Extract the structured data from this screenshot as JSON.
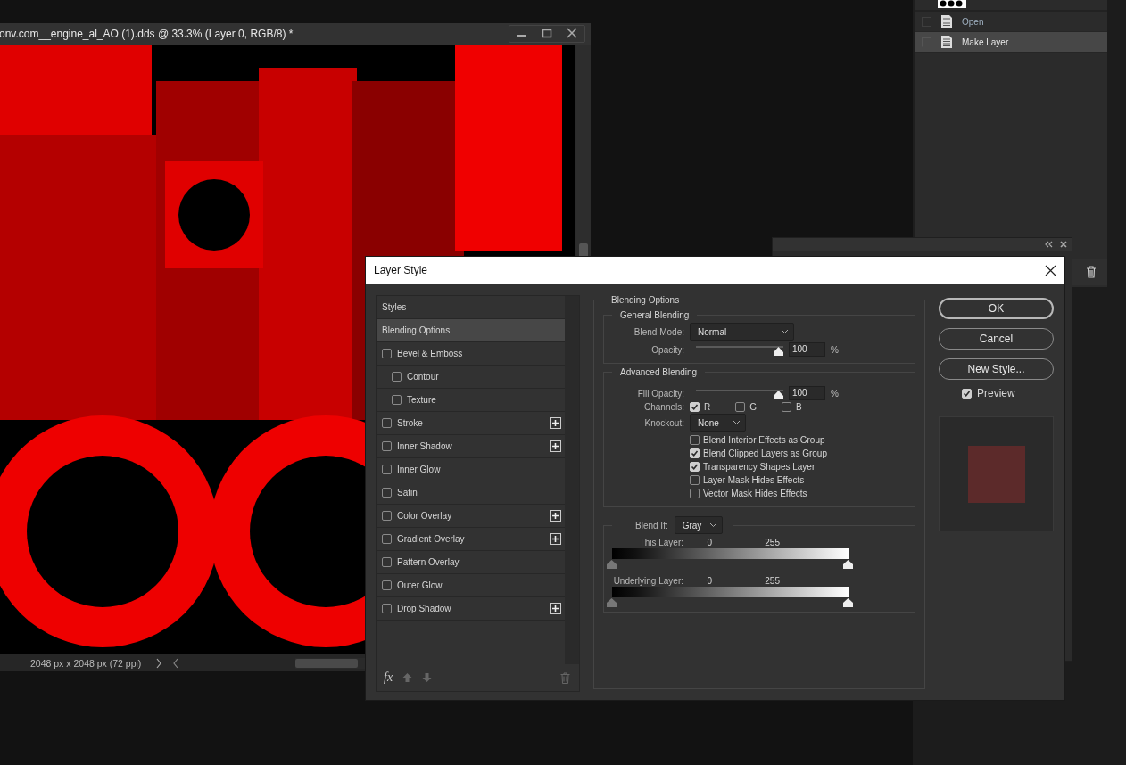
{
  "document": {
    "title": "onv.com__engine_al_AO (1).dds @ 33.3% (Layer 0, RGB/8) *",
    "status": "2048 px x 2048 px (72 ppi)"
  },
  "history": {
    "items": [
      {
        "label": "Open",
        "selected": false
      },
      {
        "label": "Make Layer",
        "selected": true
      }
    ]
  },
  "dialog": {
    "title": "Layer Style",
    "styles": [
      {
        "kind": "heading",
        "label": "Styles",
        "selected": false
      },
      {
        "kind": "heading",
        "label": "Blending Options",
        "selected": true
      },
      {
        "kind": "effect",
        "label": "Bevel & Emboss",
        "checked": false,
        "addable": false,
        "selected": false
      },
      {
        "kind": "sub",
        "label": "Contour",
        "checked": false,
        "addable": false,
        "selected": false
      },
      {
        "kind": "sub",
        "label": "Texture",
        "checked": false,
        "addable": false,
        "selected": false
      },
      {
        "kind": "effect",
        "label": "Stroke",
        "checked": false,
        "addable": true,
        "selected": false
      },
      {
        "kind": "effect",
        "label": "Inner Shadow",
        "checked": false,
        "addable": true,
        "selected": false
      },
      {
        "kind": "effect",
        "label": "Inner Glow",
        "checked": false,
        "addable": false,
        "selected": false
      },
      {
        "kind": "effect",
        "label": "Satin",
        "checked": false,
        "addable": false,
        "selected": false
      },
      {
        "kind": "effect",
        "label": "Color Overlay",
        "checked": false,
        "addable": true,
        "selected": false
      },
      {
        "kind": "effect",
        "label": "Gradient Overlay",
        "checked": false,
        "addable": true,
        "selected": false
      },
      {
        "kind": "effect",
        "label": "Pattern Overlay",
        "checked": false,
        "addable": false,
        "selected": false
      },
      {
        "kind": "effect",
        "label": "Outer Glow",
        "checked": false,
        "addable": false,
        "selected": false
      },
      {
        "kind": "effect",
        "label": "Drop Shadow",
        "checked": false,
        "addable": true,
        "selected": false
      }
    ],
    "fx_label": "fx",
    "blending": {
      "legend": "Blending Options",
      "general": {
        "legend": "General Blending",
        "blend_mode_label": "Blend Mode:",
        "blend_mode": "Normal",
        "opacity_label": "Opacity:",
        "opacity": {
          "level": 1,
          "value": "100",
          "unit": "%"
        }
      },
      "advanced": {
        "legend": "Advanced Blending",
        "fill_opacity_label": "Fill Opacity:",
        "fill_opacity": {
          "level": 1,
          "value": "100",
          "unit": "%"
        },
        "channels_label": "Channels:",
        "channels": [
          {
            "label": "R",
            "checked": true
          },
          {
            "label": "G",
            "checked": false
          },
          {
            "label": "B",
            "checked": false
          }
        ],
        "knockout_label": "Knockout:",
        "knockout": "None",
        "options": [
          {
            "label": "Blend Interior Effects as Group",
            "checked": false
          },
          {
            "label": "Blend Clipped Layers as Group",
            "checked": true
          },
          {
            "label": "Transparency Shapes Layer",
            "checked": true
          },
          {
            "label": "Layer Mask Hides Effects",
            "checked": false
          },
          {
            "label": "Vector Mask Hides Effects",
            "checked": false
          }
        ]
      },
      "blend_if": {
        "label": "Blend If:",
        "value": "Gray",
        "layers": [
          {
            "label": "This Layer:",
            "min": "0",
            "max": "255",
            "low": {
              "level": 0
            },
            "high": {
              "level": 1
            }
          },
          {
            "label": "Underlying Layer:",
            "min": "0",
            "max": "255",
            "low": {
              "level": 0
            },
            "high": {
              "level": 1
            }
          }
        ]
      }
    },
    "buttons": [
      {
        "label": "OK",
        "default": true
      },
      {
        "label": "Cancel",
        "default": false
      },
      {
        "label": "New Style...",
        "default": false
      }
    ],
    "preview": {
      "label": "Preview",
      "checked": true
    }
  }
}
